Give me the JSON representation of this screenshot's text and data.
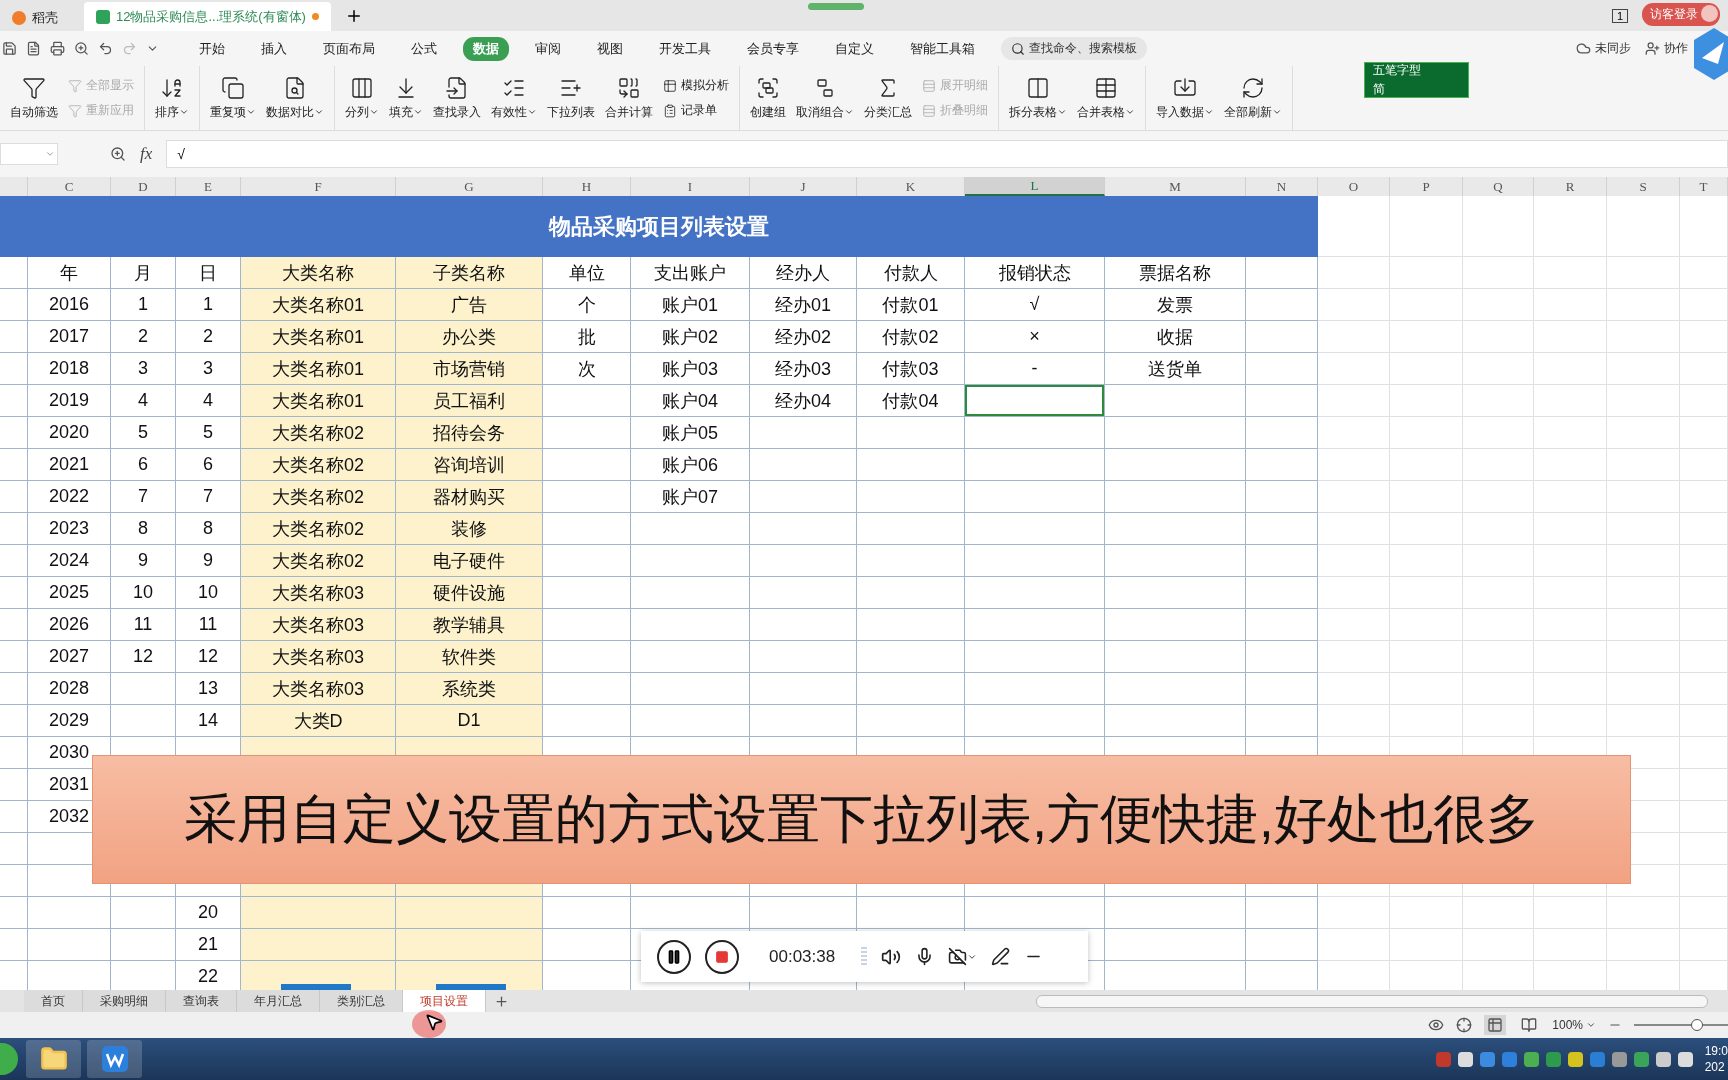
{
  "browser_tabs": [
    {
      "title": "稻壳",
      "selected": false
    },
    {
      "title": "12物品采购信息...理系统(有窗体)",
      "selected": true
    }
  ],
  "account": {
    "badge": "1",
    "login": "访客登录"
  },
  "menu": [
    {
      "label": "开始",
      "selected": false
    },
    {
      "label": "插入",
      "selected": false
    },
    {
      "label": "页面布局",
      "selected": false
    },
    {
      "label": "公式",
      "selected": false
    },
    {
      "label": "数据",
      "selected": true
    },
    {
      "label": "审阅",
      "selected": false
    },
    {
      "label": "视图",
      "selected": false
    },
    {
      "label": "开发工具",
      "selected": false
    },
    {
      "label": "会员专享",
      "selected": false
    },
    {
      "label": "自定义",
      "selected": false
    },
    {
      "label": "智能工具箱",
      "selected": false
    }
  ],
  "search": {
    "placeholder": "查找命令、搜索模板"
  },
  "cloud": {
    "sync": "未同步",
    "collab": "协作"
  },
  "ribbon": [
    {
      "items": [
        {
          "label": "自动筛选",
          "kind": "big",
          "dropdown": false,
          "disabled": false
        },
        {
          "label": "全部显示",
          "kind": "small",
          "dropdown": false,
          "disabled": true
        },
        {
          "label": "重新应用",
          "kind": "small",
          "dropdown": false,
          "disabled": true
        }
      ]
    },
    {
      "items": [
        {
          "label": "排序",
          "kind": "big",
          "dropdown": true,
          "disabled": false
        }
      ]
    },
    {
      "items": [
        {
          "label": "重复项",
          "kind": "big",
          "dropdown": true,
          "disabled": false
        },
        {
          "label": "数据对比",
          "kind": "big",
          "dropdown": true,
          "disabled": false
        }
      ]
    },
    {
      "items": [
        {
          "label": "分列",
          "kind": "big",
          "dropdown": true,
          "disabled": false
        },
        {
          "label": "填充",
          "kind": "big",
          "dropdown": true,
          "disabled": false
        },
        {
          "label": "查找录入",
          "kind": "big",
          "dropdown": false,
          "disabled": false
        },
        {
          "label": "有效性",
          "kind": "big",
          "dropdown": true,
          "disabled": false
        },
        {
          "label": "下拉列表",
          "kind": "big",
          "dropdown": false,
          "disabled": false
        },
        {
          "label": "合并计算",
          "kind": "big",
          "dropdown": false,
          "disabled": false
        },
        {
          "label": "模拟分析",
          "kind": "small",
          "dropdown": false,
          "disabled": false
        },
        {
          "label": "记录单",
          "kind": "small",
          "dropdown": false,
          "disabled": false
        }
      ]
    },
    {
      "items": [
        {
          "label": "创建组",
          "kind": "big",
          "dropdown": false,
          "disabled": false
        },
        {
          "label": "取消组合",
          "kind": "big",
          "dropdown": true,
          "disabled": false
        },
        {
          "label": "分类汇总",
          "kind": "big",
          "dropdown": false,
          "disabled": false
        },
        {
          "label": "展开明细",
          "kind": "small",
          "dropdown": false,
          "disabled": true
        },
        {
          "label": "折叠明细",
          "kind": "small",
          "dropdown": false,
          "disabled": true
        }
      ]
    },
    {
      "items": [
        {
          "label": "拆分表格",
          "kind": "big",
          "dropdown": true,
          "disabled": false
        },
        {
          "label": "合并表格",
          "kind": "big",
          "dropdown": true,
          "disabled": false
        }
      ]
    },
    {
      "items": [
        {
          "label": "导入数据",
          "kind": "big",
          "dropdown": true,
          "disabled": false
        },
        {
          "label": "全部刷新",
          "kind": "big",
          "dropdown": true,
          "disabled": false
        }
      ]
    }
  ],
  "ime": {
    "mode": "五笔字型",
    "script": "简"
  },
  "formula_bar": {
    "label": "fx",
    "value": "√"
  },
  "columns": [
    {
      "letter": "C",
      "selected": false
    },
    {
      "letter": "D",
      "selected": false
    },
    {
      "letter": "E",
      "selected": false
    },
    {
      "letter": "F",
      "selected": false
    },
    {
      "letter": "G",
      "selected": false
    },
    {
      "letter": "H",
      "selected": false
    },
    {
      "letter": "I",
      "selected": false
    },
    {
      "letter": "J",
      "selected": false
    },
    {
      "letter": "K",
      "selected": false
    },
    {
      "letter": "L",
      "selected": true
    },
    {
      "letter": "M",
      "selected": false
    },
    {
      "letter": "N",
      "selected": false
    },
    {
      "letter": "O",
      "selected": false
    },
    {
      "letter": "P",
      "selected": false
    },
    {
      "letter": "Q",
      "selected": false
    },
    {
      "letter": "R",
      "selected": false
    },
    {
      "letter": "S",
      "selected": false
    },
    {
      "letter": "T",
      "selected": false
    }
  ],
  "sheet": {
    "title": "物品采购项目列表设置",
    "headers": [
      "年",
      "月",
      "日",
      "大类名称",
      "子类名称",
      "单位",
      "支出账户",
      "经办人",
      "付款人",
      "报销状态",
      "票据名称"
    ],
    "rows": [
      {
        "year": "2016",
        "month": "1",
        "day": "1",
        "category": "大类名称01",
        "subcategory": "广告",
        "unit": "个",
        "account": "账户01",
        "handler": "经办01",
        "payer": "付款01",
        "status": "√",
        "document": "发票",
        "status_selected": false,
        "bar_shape": false
      },
      {
        "year": "2017",
        "month": "2",
        "day": "2",
        "category": "大类名称01",
        "subcategory": "办公类",
        "unit": "批",
        "account": "账户02",
        "handler": "经办02",
        "payer": "付款02",
        "status": "×",
        "document": "收据",
        "status_selected": false,
        "bar_shape": false
      },
      {
        "year": "2018",
        "month": "3",
        "day": "3",
        "category": "大类名称01",
        "subcategory": "市场营销",
        "unit": "次",
        "account": "账户03",
        "handler": "经办03",
        "payer": "付款03",
        "status": "-",
        "document": "送货单",
        "status_selected": false,
        "bar_shape": false
      },
      {
        "year": "2019",
        "month": "4",
        "day": "4",
        "category": "大类名称01",
        "subcategory": "员工福利",
        "account": "账户04",
        "handler": "经办04",
        "payer": "付款04",
        "status_selected": true,
        "bar_shape": false
      },
      {
        "year": "2020",
        "month": "5",
        "day": "5",
        "category": "大类名称02",
        "subcategory": "招待会务",
        "account": "账户05",
        "status_selected": false,
        "bar_shape": false
      },
      {
        "year": "2021",
        "month": "6",
        "day": "6",
        "category": "大类名称02",
        "subcategory": "咨询培训",
        "account": "账户06",
        "status_selected": false,
        "bar_shape": false
      },
      {
        "year": "2022",
        "month": "7",
        "day": "7",
        "category": "大类名称02",
        "subcategory": "器材购买",
        "account": "账户07",
        "status_selected": false,
        "bar_shape": false
      },
      {
        "year": "2023",
        "month": "8",
        "day": "8",
        "category": "大类名称02",
        "subcategory": "装修",
        "status_selected": false,
        "bar_shape": false
      },
      {
        "year": "2024",
        "month": "9",
        "day": "9",
        "category": "大类名称02",
        "subcategory": "电子硬件",
        "status_selected": false,
        "bar_shape": false
      },
      {
        "year": "2025",
        "month": "10",
        "day": "10",
        "category": "大类名称03",
        "subcategory": "硬件设施",
        "status_selected": false,
        "bar_shape": false
      },
      {
        "year": "2026",
        "month": "11",
        "day": "11",
        "category": "大类名称03",
        "subcategory": "教学辅具",
        "status_selected": false,
        "bar_shape": false
      },
      {
        "year": "2027",
        "month": "12",
        "day": "12",
        "category": "大类名称03",
        "subcategory": "软件类",
        "status_selected": false,
        "bar_shape": false
      },
      {
        "year": "2028",
        "day": "13",
        "category": "大类名称03",
        "subcategory": "系统类",
        "status_selected": false,
        "bar_shape": false
      },
      {
        "year": "2029",
        "day": "14",
        "category": "大类D",
        "subcategory": "D1",
        "status_selected": false,
        "bar_shape": false
      },
      {
        "year": "2030",
        "status_selected": false
      },
      {
        "year": "2031"
      },
      {
        "year": "2032"
      },
      {},
      {
        "status_selected": false,
        "bar_shape": false
      },
      {
        "day": "20",
        "status_selected": false,
        "bar_shape": false
      },
      {
        "day": "21",
        "status_selected": false,
        "bar_shape": false
      },
      {
        "day": "22",
        "status_selected": false,
        "bar_shape": true
      }
    ]
  },
  "caption": "采用自定义设置的方式设置下拉列表,方便快捷,好处也很多",
  "sheet_tabs": [
    {
      "label": "首页",
      "selected": false
    },
    {
      "label": "采购明细",
      "selected": false
    },
    {
      "label": "查询表",
      "selected": false
    },
    {
      "label": "年月汇总",
      "selected": false
    },
    {
      "label": "类别汇总",
      "selected": false
    },
    {
      "label": "项目设置",
      "selected": true
    }
  ],
  "recorder": {
    "time": "00:03:38"
  },
  "status_bar": {
    "zoom": "100%",
    "zoom_slider": {
      "level": 0.62
    }
  },
  "taskbar": {
    "clock_time": "19:0",
    "clock_date": "202"
  }
}
